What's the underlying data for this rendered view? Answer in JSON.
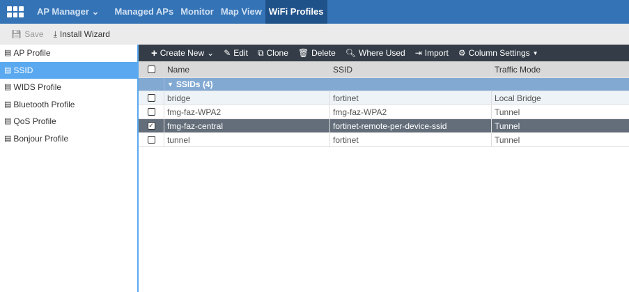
{
  "topnav": {
    "app": "AP Manager",
    "items": [
      "Managed APs",
      "Monitor",
      "Map View",
      "WiFi Profiles"
    ],
    "active": "WiFi Profiles"
  },
  "toolbar": {
    "save": "Save",
    "install": "Install Wizard"
  },
  "sidebar": {
    "items": [
      "AP Profile",
      "SSID",
      "WIDS Profile",
      "Bluetooth Profile",
      "QoS Profile",
      "Bonjour Profile"
    ],
    "selected": "SSID"
  },
  "actions": {
    "create": "Create New",
    "edit": "Edit",
    "clone": "Clone",
    "delete": "Delete",
    "where": "Where Used",
    "import": "Import",
    "columns": "Column Settings"
  },
  "table": {
    "headers": [
      "Name",
      "SSID",
      "Traffic Mode"
    ],
    "group": "SSIDs (4)",
    "rows": [
      {
        "name": "bridge",
        "ssid": "fortinet",
        "mode": "Local Bridge",
        "checked": false
      },
      {
        "name": "fmg-faz-WPA2",
        "ssid": "fmg-faz-WPA2",
        "mode": "Tunnel",
        "checked": false
      },
      {
        "name": "fmg-faz-central",
        "ssid": "fortinet-remote-per-device-ssid",
        "mode": "Tunnel",
        "checked": true
      },
      {
        "name": "tunnel",
        "ssid": "fortinet",
        "mode": "Tunnel",
        "checked": false
      }
    ]
  }
}
